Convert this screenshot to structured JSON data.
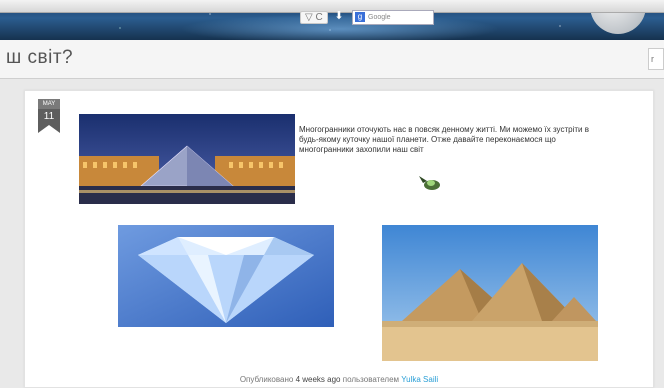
{
  "browser": {
    "url_fragment": "▽ C",
    "search_placeholder": "Google",
    "search_engine_icon": "google-g-icon"
  },
  "site": {
    "title": "ш світ?",
    "search_partial": "r"
  },
  "post": {
    "date_month": "MAY",
    "date_day": "11",
    "text": "Многогранники оточують нас в повсяк денному житті. Ми можемо їх зустріти в будь-якому куточку нашої планети. Отже давайте переконаємося що многогранники захопили наш світ",
    "byline_prefix": "Опубликовано",
    "byline_time": "4 weeks ago",
    "byline_mid": "пользователем",
    "byline_author": "Yulka Saili"
  }
}
